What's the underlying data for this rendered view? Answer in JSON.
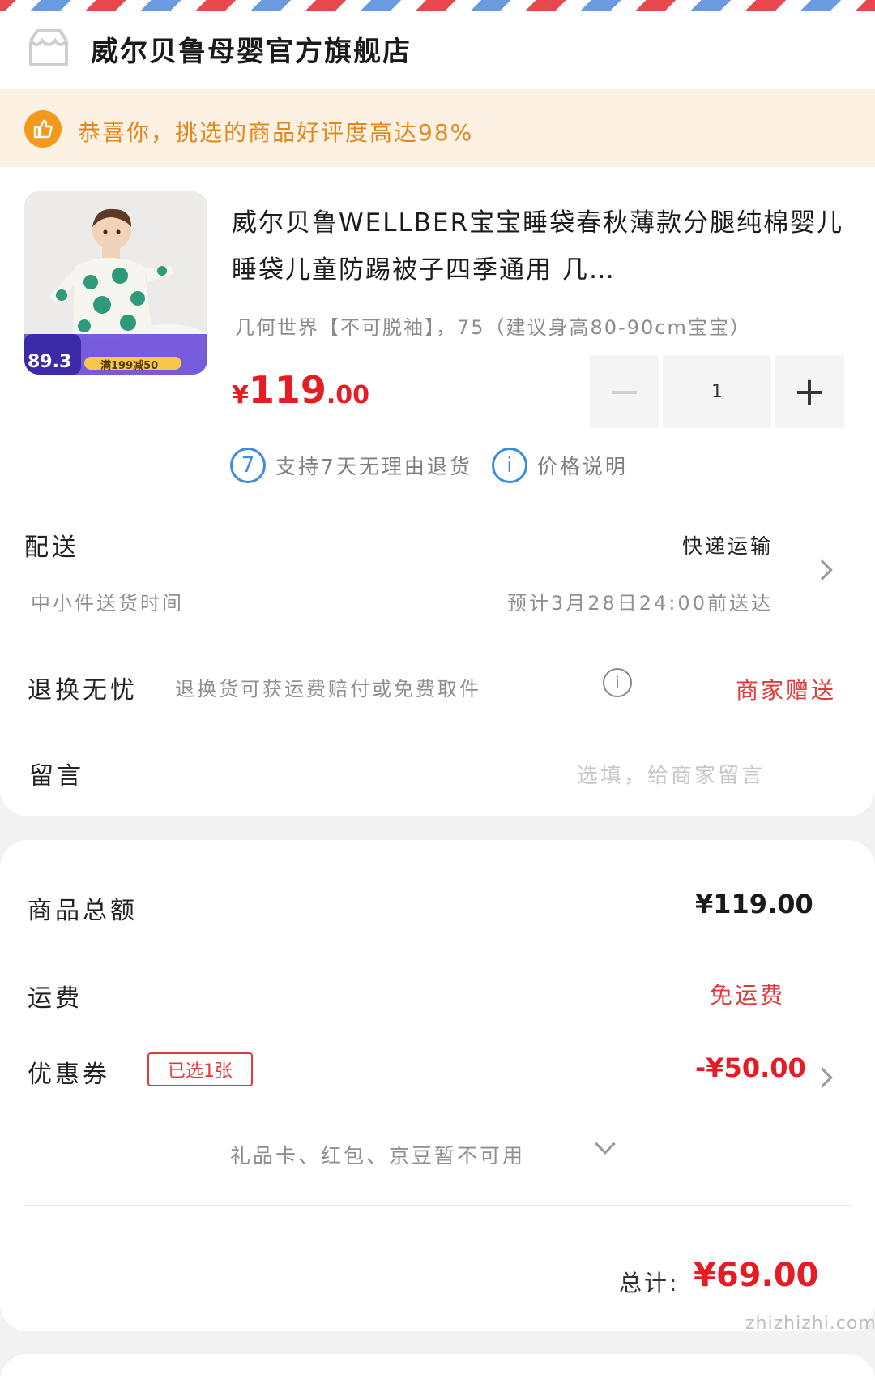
{
  "store": {
    "name": "威尔贝鲁母婴官方旗舰店",
    "icon": "store-icon"
  },
  "banner": {
    "icon": "thumbs-up-icon",
    "text": "恭喜你，挑选的商品好评度高达98%",
    "color": "#e0881d"
  },
  "product": {
    "image_label_price": "89.3",
    "image_label_promo": "满199减50",
    "title": "威尔贝鲁WELLBER宝宝睡袋春秋薄款分腿纯棉婴儿睡袋儿童防踢被子四季通用 几…",
    "spec": "几何世界【不可脱袖】，75（建议身高80-90cm宝宝）",
    "price": {
      "currency": "¥",
      "integer": "119",
      "decimal": ".00"
    },
    "quantity": "1",
    "minus_label": "−",
    "plus_label": "+"
  },
  "services": [
    {
      "icon": "seven-day-return-icon",
      "glyph": "7",
      "text": "支持7天无理由退货"
    },
    {
      "icon": "info-icon",
      "glyph": "i",
      "text": "价格说明"
    }
  ],
  "delivery": {
    "label": "配送",
    "method": "快递运输",
    "sub_label": "中小件送货时间",
    "eta": "预计3月28日24:00前送达"
  },
  "returns": {
    "label": "退换无忧",
    "desc": "退换货可获运费赔付或免费取件",
    "badge": "商家赠送",
    "badge_color": "#e23a3a"
  },
  "message": {
    "label": "留言",
    "placeholder": "选填，给商家留言"
  },
  "summary": {
    "subtotal_label": "商品总额",
    "subtotal_value": "¥119.00",
    "shipping_label": "运费",
    "shipping_value": "免运费",
    "coupon_label": "优惠券",
    "coupon_badge": "已选1张",
    "coupon_value": "-¥50.00",
    "giftcard_text": "礼品卡、红包、京豆暂不可用",
    "total_label": "总计:",
    "total_value": "¥69.00"
  },
  "colors": {
    "accent_red": "#e51c23",
    "info_blue": "#3c8de0"
  },
  "watermark": "zhizhizhi.com"
}
